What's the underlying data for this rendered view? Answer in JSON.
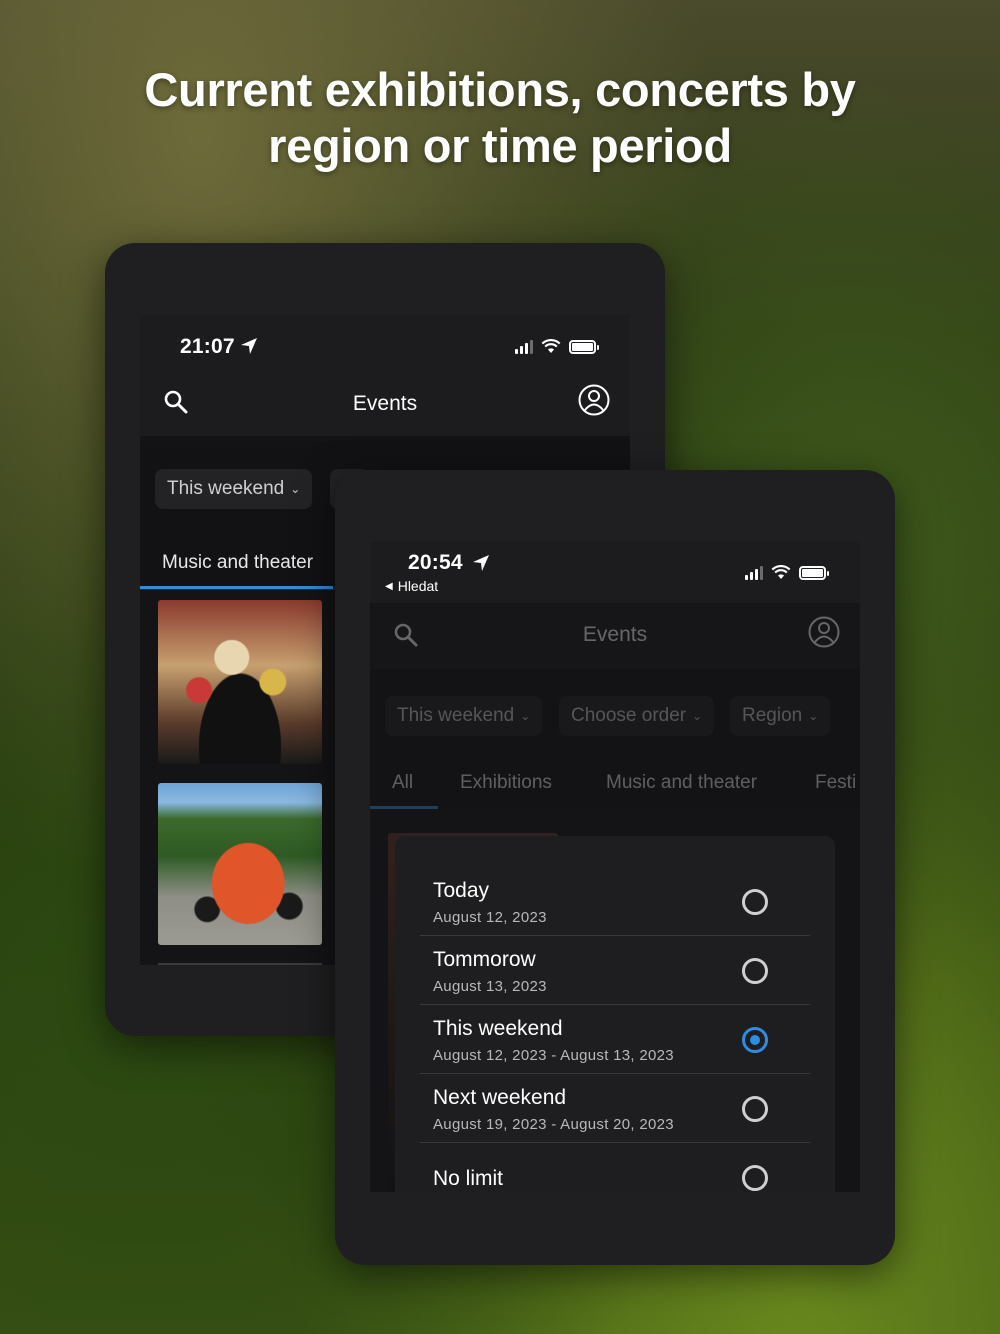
{
  "headline": {
    "line1": "Current exhibitions, concerts by",
    "line2": "region or time period"
  },
  "back_screen": {
    "time": "21:07",
    "title": "Events",
    "filter_chip": "This weekend",
    "active_tab": "Music and theater"
  },
  "front_screen": {
    "time": "20:54",
    "back_link": "Hledat",
    "title": "Events",
    "filters": [
      "This weekend",
      "Choose order",
      "Region"
    ],
    "tabs": [
      "All",
      "Exhibitions",
      "Music and theater",
      "Festi"
    ],
    "options": [
      {
        "title": "Today",
        "subtitle": "August 12, 2023",
        "selected": false
      },
      {
        "title": "Tommorow",
        "subtitle": "August 13, 2023",
        "selected": false
      },
      {
        "title": "This weekend",
        "subtitle": "August 12, 2023 - August 13, 2023",
        "selected": true
      },
      {
        "title": "Next weekend",
        "subtitle": "August 19, 2023 - August 20, 2023",
        "selected": false
      },
      {
        "title": "No limit",
        "subtitle": "",
        "selected": false
      }
    ]
  },
  "colors": {
    "accent": "#2e8de0",
    "surface": "#1f1f21",
    "screen": "#141416"
  },
  "icons": [
    "location-arrow-icon",
    "signal-icon",
    "wifi-icon",
    "battery-icon",
    "search-icon",
    "profile-icon",
    "chevron-down-icon",
    "back-triangle-icon",
    "radio-icon"
  ]
}
